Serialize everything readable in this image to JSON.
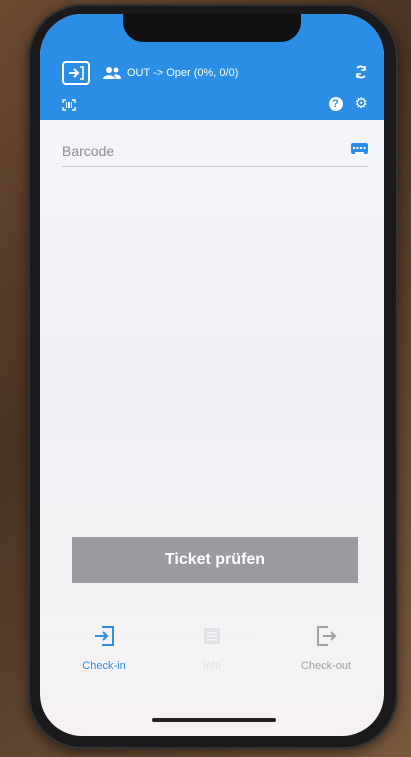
{
  "header": {
    "mode_text": "OUT -> Oper (0%, 0/0)",
    "help_glyph": "?"
  },
  "barcode": {
    "placeholder": "Barcode",
    "value": ""
  },
  "check_button": {
    "label": "Ticket prüfen"
  },
  "tabs": [
    {
      "label": "Check-in",
      "active": true
    },
    {
      "label": "Info",
      "active": false
    },
    {
      "label": "Check-out",
      "active": false
    }
  ],
  "colors": {
    "accent": "#2a8ee6",
    "button_disabled": "#9a9aa0",
    "tab_inactive": "#a0a0a6"
  },
  "icons": {
    "header_left": "check-in-icon",
    "group": "group-icon",
    "sync": "sync-icon",
    "scan": "barcode-scan-icon",
    "help": "help-icon",
    "settings": "gear-icon",
    "keyboard": "keyboard-icon",
    "tab_checkin": "check-in-icon",
    "tab_info": "list-icon",
    "tab_checkout": "check-out-icon"
  }
}
